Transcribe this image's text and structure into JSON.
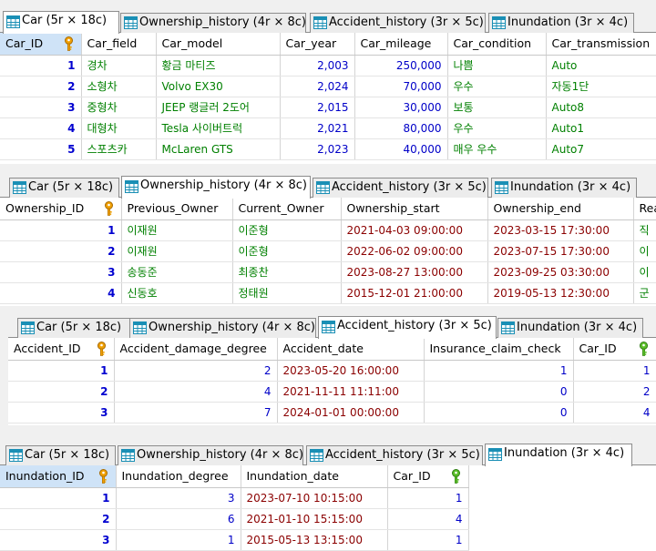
{
  "tab_labels": [
    "Car (5r × 18c)",
    "Ownership_history (4r × 8c)",
    "Accident_history (3r × 5c)",
    "Inundation (3r × 4c)"
  ],
  "panels": [
    {
      "active_tab": 0,
      "columns": [
        "Car_ID",
        "Car_field",
        "Car_model",
        "Car_year",
        "Car_mileage",
        "Car_condition",
        "Car_transmission"
      ],
      "rows": [
        [
          "1",
          "경차",
          "황금 마티즈",
          "2,003",
          "250,000",
          "나쁨",
          "Auto"
        ],
        [
          "2",
          "소형차",
          "Volvo EX30",
          "2,024",
          "70,000",
          "우수",
          "자동1단"
        ],
        [
          "3",
          "중형차",
          "JEEP 랭글러 2도어",
          "2,015",
          "30,000",
          "보통",
          "Auto8"
        ],
        [
          "4",
          "대형차",
          "Tesla 사이버트럭",
          "2,021",
          "80,000",
          "우수",
          "Auto1"
        ],
        [
          "5",
          "스포츠카",
          "McLaren GTS",
          "2,023",
          "40,000",
          "매우 우수",
          "Auto7"
        ]
      ]
    },
    {
      "active_tab": 1,
      "columns": [
        "Ownership_ID",
        "Previous_Owner",
        "Current_Owner",
        "Ownership_start",
        "Ownership_end",
        "Rea"
      ],
      "rows": [
        [
          "1",
          "이재원",
          "이준형",
          "2021-04-03 09:00:00",
          "2023-03-15 17:30:00",
          "직"
        ],
        [
          "2",
          "이재원",
          "이준형",
          "2022-06-02 09:00:00",
          "2023-07-15 17:30:00",
          "이"
        ],
        [
          "3",
          "송동준",
          "최종찬",
          "2023-08-27 13:00:00",
          "2023-09-25 03:30:00",
          "이"
        ],
        [
          "4",
          "신동호",
          "정태원",
          "2015-12-01 21:00:00",
          "2019-05-13 12:30:00",
          "군"
        ]
      ]
    },
    {
      "active_tab": 2,
      "columns": [
        "Accident_ID",
        "Accident_damage_degree",
        "Accident_date",
        "Insurance_claim_check",
        "Car_ID"
      ],
      "rows": [
        [
          "1",
          "2",
          "2023-05-20 16:00:00",
          "1",
          "1"
        ],
        [
          "2",
          "4",
          "2021-11-11 11:11:00",
          "0",
          "2"
        ],
        [
          "3",
          "7",
          "2024-01-01 00:00:00",
          "0",
          "4"
        ]
      ]
    },
    {
      "active_tab": 3,
      "columns": [
        "Inundation_ID",
        "Inundation_degree",
        "Inundation_date",
        "Car_ID"
      ],
      "rows": [
        [
          "1",
          "3",
          "2023-07-10 10:15:00",
          "1"
        ],
        [
          "2",
          "6",
          "2021-01-10 15:15:00",
          "4"
        ],
        [
          "3",
          "1",
          "2015-05-13 13:15:00",
          "1"
        ]
      ]
    }
  ],
  "colors": {
    "primary_key": "#f0a000",
    "foreign_key": "#5cbf2a",
    "row_number": "#0000d0",
    "numeric": "#0000c8",
    "text": "#008000",
    "datetime": "#8b0000",
    "selected_header": "#cfe3f7"
  },
  "icons": {
    "tab": "table-icon",
    "primary_key": "key-icon",
    "foreign_key": "foreign-key-icon"
  }
}
